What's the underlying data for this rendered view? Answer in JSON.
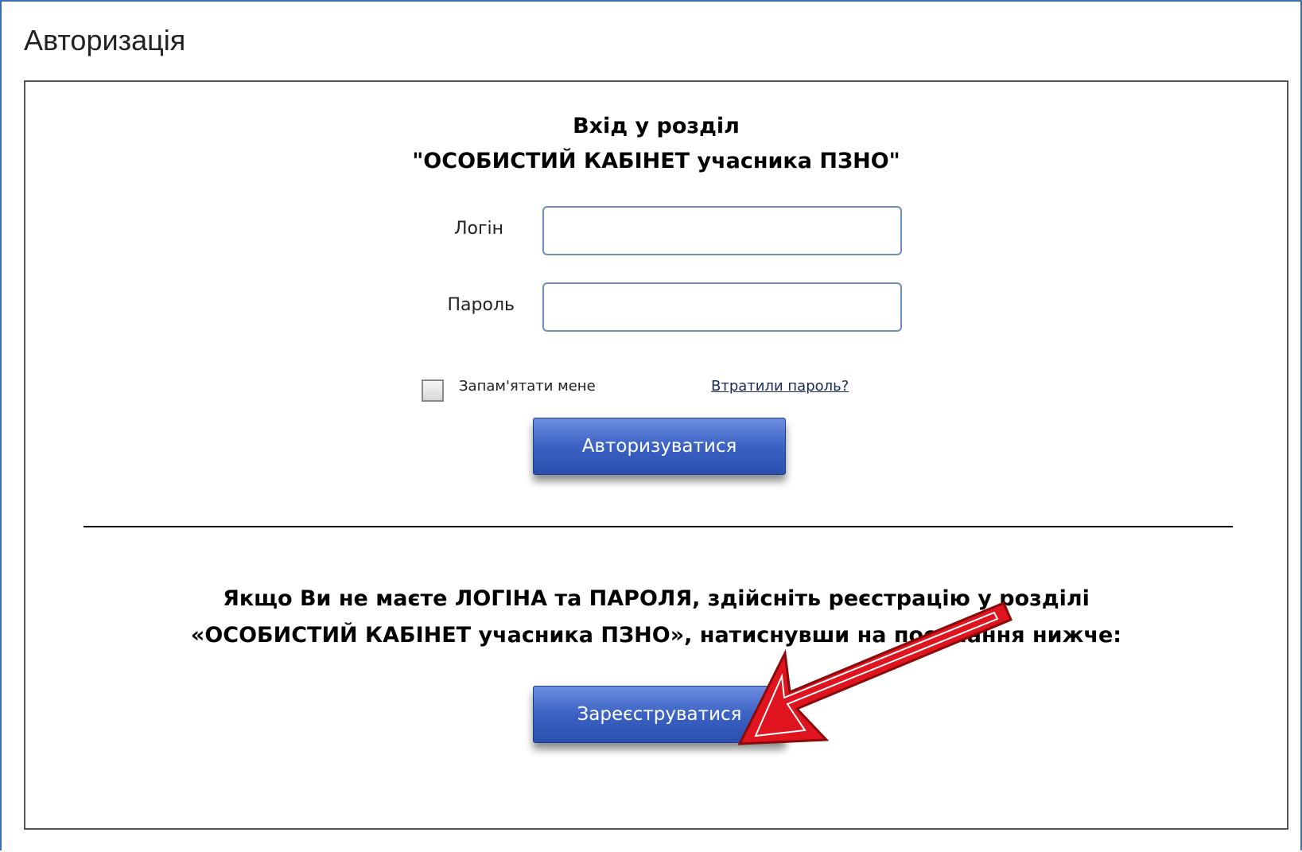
{
  "page": {
    "title": "Авторизація"
  },
  "login_panel": {
    "heading_line1": "Вхід у розділ",
    "heading_line2": "\"ОСОБИСТИЙ КАБІНЕТ учасника ПЗНО\"",
    "login_label": "Логін",
    "login_value": "",
    "password_label": "Пароль",
    "password_value": "",
    "remember_label": "Запам'ятати мене",
    "remember_checked": false,
    "lost_password_link": "Втратили пароль?",
    "login_button": "Авторизуватися"
  },
  "registration": {
    "text_line1": "Якщо Ви не маєте ЛОГІНА та ПАРОЛЯ, здійсніть реєстрацію у розділі",
    "text_line2": "«ОСОБИСТИЙ КАБІНЕТ учасника ПЗНО», натиснувши на посилання нижче:",
    "register_button": "Зареєструватися"
  },
  "colors": {
    "frame_border": "#3b6fb0",
    "button_blue": "#3b62c4",
    "arrow_red": "#e0141e"
  }
}
